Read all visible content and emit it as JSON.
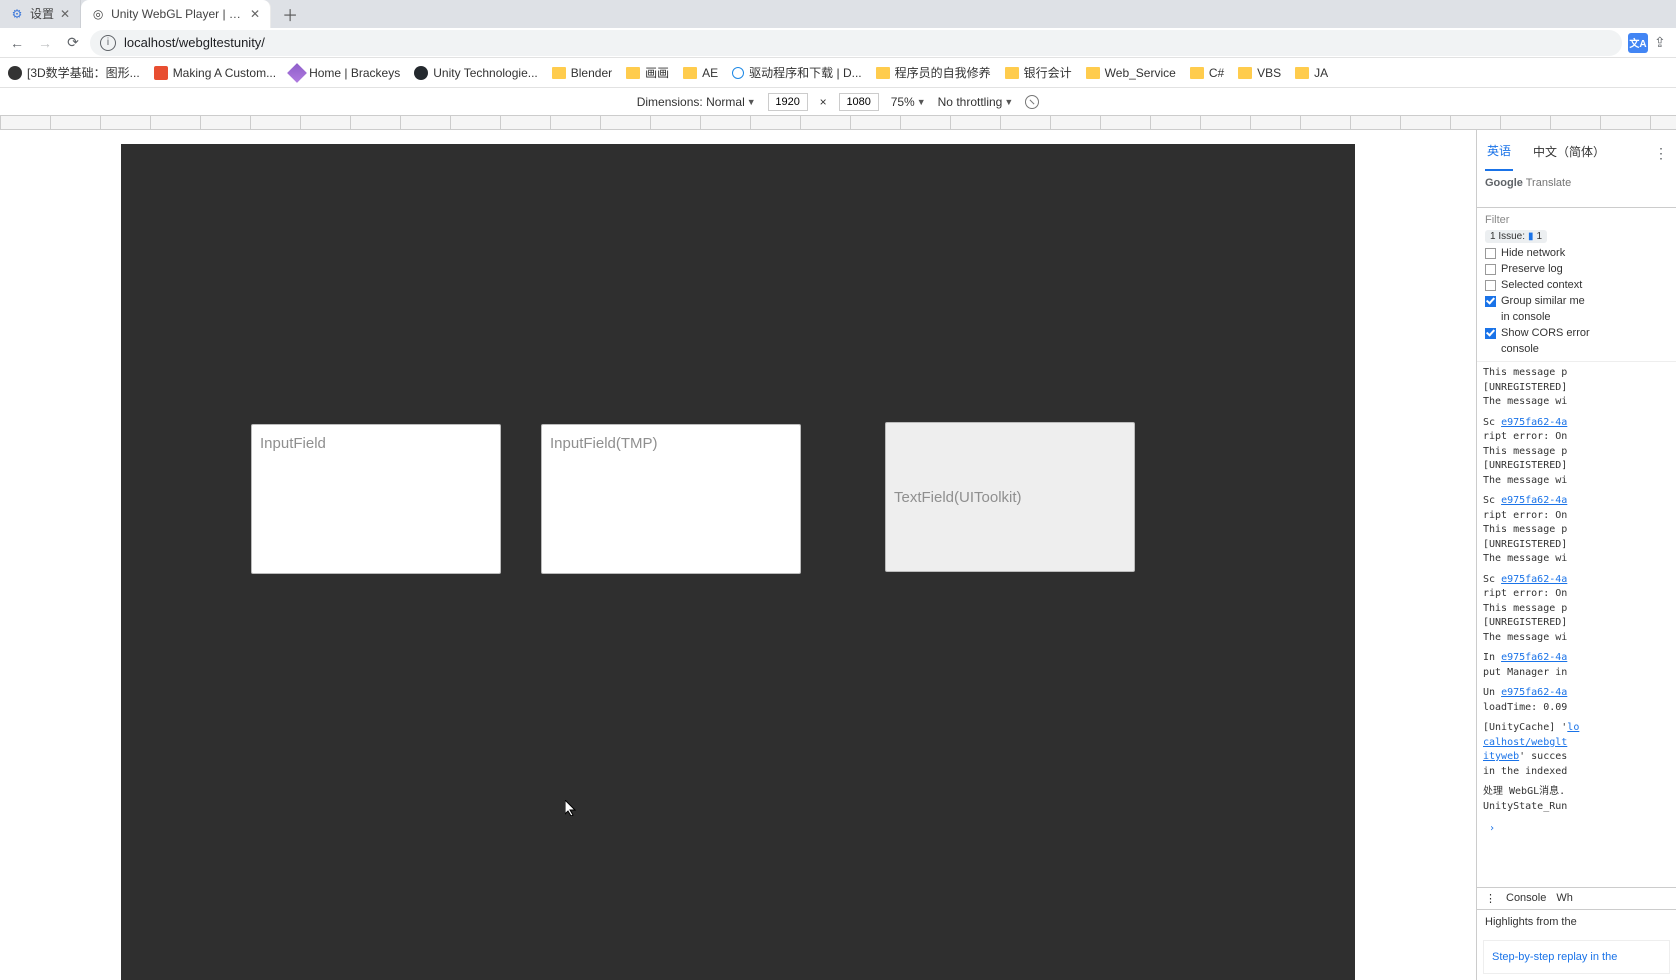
{
  "tabs": {
    "t0": {
      "title": "设置"
    },
    "t1": {
      "title": "Unity WebGL Player | My proje"
    }
  },
  "addr": {
    "url": "localhost/webgltestunity/"
  },
  "bookmarks": {
    "b0": "[3D数学基础：图形...",
    "b1": "Making A Custom...",
    "b2": "Home | Brackeys",
    "b3": "Unity Technologie...",
    "b4": "Blender",
    "b5": "画画",
    "b6": "AE",
    "b7": "驱动程序和下载 | D...",
    "b8": "程序员的自我修养",
    "b9": "银行会计",
    "b10": "Web_Service",
    "b11": "C#",
    "b12": "VBS",
    "b13": "JA"
  },
  "device_bar": {
    "dimensions_label": "Dimensions: Normal",
    "w": "1920",
    "sep": "×",
    "h": "1080",
    "zoom": "75%",
    "throttling": "No throttling"
  },
  "canvas": {
    "f1": "InputField",
    "f2": "InputField(TMP)",
    "f3": "TextField(UIToolkit)"
  },
  "translate": {
    "tab_en": "英语",
    "tab_zh": "中文（简体）",
    "brand1": "Google",
    "brand2": "Translate"
  },
  "devtools": {
    "filter": "Filter",
    "issue": "1 Issue:",
    "issue_count": "1",
    "hide_net": "Hide network",
    "preserve": "Preserve log",
    "selctx": "Selected context",
    "group": "Group similar me",
    "group2": "in console",
    "cors": "Show CORS error",
    "cors2": "console",
    "tab_console": "Console",
    "tab_what": "Wh",
    "highlights": "Highlights from the",
    "video": "Step-by-step replay in the"
  },
  "console_lines": {
    "l0": "This message p",
    "l1": "[UNREGISTERED]",
    "l2": "The message wi",
    "l3": "Sc ",
    "link": "e975fa62-4a",
    "l4": "ript error: On",
    "l5": "In ",
    "l6": "put Manager in",
    "l7": "Un ",
    "l8": "loadTime: 0.09",
    "l9": "[UnityCache] '",
    "l10": "calhost/webglt",
    "l11": "ityweb' succes",
    "l12": "in the indexed",
    "l13": "处理 WebGL消息.",
    "l14": "UnityState_Run"
  }
}
